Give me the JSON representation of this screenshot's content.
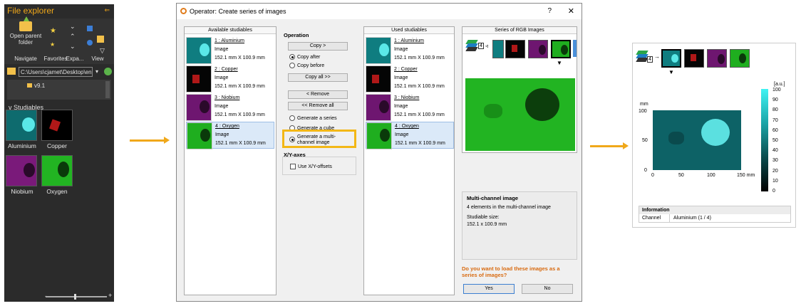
{
  "file_explorer": {
    "title": "File explorer",
    "ribbon": {
      "open_parent": "Open parent folder",
      "navigate": "Navigate",
      "favorites": "Favorites",
      "expand": "Expa...",
      "view": "View"
    },
    "path": "C:\\Users\\cjamet\\Desktop\\en cc",
    "tree_item": "v9.1",
    "section": "Studiables",
    "thumbnails": [
      {
        "label": "Aluminium",
        "color": "#0e6b6e"
      },
      {
        "label": "Copper",
        "color": "#000000"
      },
      {
        "label": "Niobium",
        "color": "#7a1a7a"
      },
      {
        "label": "Oxygen",
        "color": "#22b422"
      }
    ],
    "zoom_minus": "-",
    "zoom_plus": "+"
  },
  "dialog": {
    "title": "Operator: Create series of images",
    "help": "?",
    "close": "✕",
    "available_head": "Available studiables",
    "used_head": "Used studiables",
    "series_head": "Series of RGB Images",
    "items": [
      {
        "name": "1 : Aluminium",
        "type": "Image",
        "size": "152.1 mm X 100.9 mm",
        "color": "#0f7d80"
      },
      {
        "name": "2 : Copper",
        "type": "Image",
        "size": "152.1 mm X 100.9 mm",
        "color": "#050505"
      },
      {
        "name": "3 : Niobium",
        "type": "Image",
        "size": "152.1 mm X 100.9 mm",
        "color": "#6e1670"
      },
      {
        "name": "4 : Oxygen",
        "type": "Image",
        "size": "152.1 mm X 100.9 mm",
        "color": "#1fae1f"
      }
    ],
    "operation": {
      "head": "Operation",
      "copy": "Copy >",
      "copy_after": "Copy after",
      "copy_before": "Copy before",
      "copy_all": "Copy all >>",
      "remove": "< Remove",
      "remove_all": "<< Remove all",
      "gen_series": "Generate a series",
      "gen_cube": "Generate a cube",
      "gen_multi": "Generate a multi-channel image"
    },
    "axes": {
      "head": "X/Y-axes",
      "offsets": "Use X/Y-offsets"
    },
    "series_count": "4",
    "info": {
      "head": "Multi-channel image",
      "line1": "4 elements in the multi-channel image",
      "line2": "Studiable size:",
      "line3": "152.1 x 100.9 mm"
    },
    "question": "Do you want to load these images as a series of images?",
    "yes": "Yes",
    "no": "No"
  },
  "result": {
    "series_count": "4",
    "y_unit": "mm",
    "y_ticks": [
      "100",
      "50",
      "0"
    ],
    "x_ticks": [
      "0",
      "50",
      "100",
      "150 mm"
    ],
    "cbar_unit": "[a.u.]",
    "cbar_ticks": [
      "100",
      "90",
      "80",
      "70",
      "60",
      "50",
      "40",
      "30",
      "20",
      "10",
      "0"
    ],
    "info_head": "Information",
    "channel_label": "Channel",
    "channel_value": "Aluminium (1 / 4)"
  }
}
